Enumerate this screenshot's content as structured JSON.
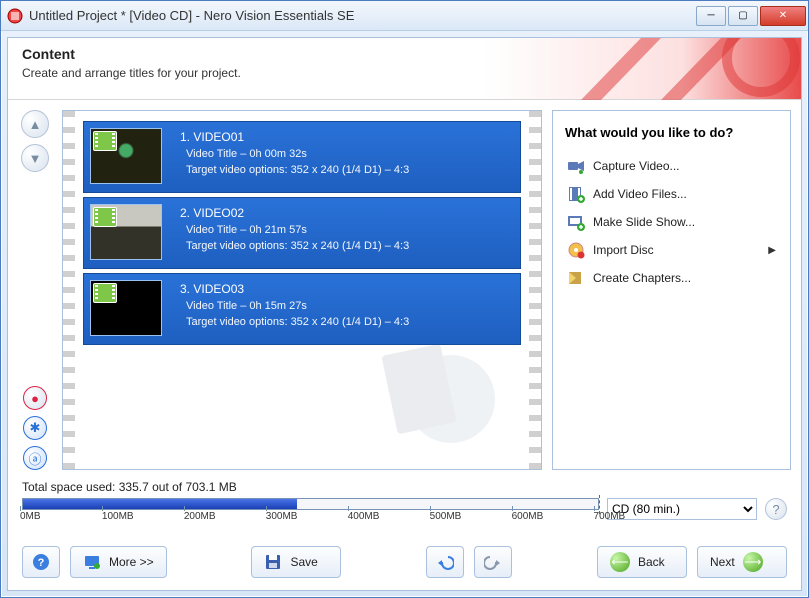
{
  "window": {
    "title": "Untitled Project * [Video CD] - Nero Vision Essentials SE"
  },
  "header": {
    "title": "Content",
    "subtitle": "Create and arrange titles for your project."
  },
  "videos": [
    {
      "index": "1.",
      "name": "VIDEO01",
      "title_line": "Video Title – 0h 00m 32s",
      "options_line": "Target video options: 352 x 240 (1/4 D1) – 4:3"
    },
    {
      "index": "2.",
      "name": "VIDEO02",
      "title_line": "Video Title – 0h 21m 57s",
      "options_line": "Target video options: 352 x 240 (1/4 D1) – 4:3"
    },
    {
      "index": "3.",
      "name": "VIDEO03",
      "title_line": "Video Title – 0h 15m 27s",
      "options_line": "Target video options: 352 x 240 (1/4 D1) – 4:3"
    }
  ],
  "side": {
    "heading": "What would you like to do?",
    "actions": [
      {
        "label": "Capture Video..."
      },
      {
        "label": "Add Video Files..."
      },
      {
        "label": "Make Slide Show..."
      },
      {
        "label": "Import Disc",
        "submenu": true
      },
      {
        "label": "Create Chapters..."
      }
    ]
  },
  "footer": {
    "space_text": "Total space used: 335.7 out of 703.1 MB",
    "ticks": [
      "0MB",
      "100MB",
      "200MB",
      "300MB",
      "400MB",
      "500MB",
      "600MB",
      "700MB"
    ],
    "fill_percent": 47.7,
    "redmark_percent": 100,
    "disc_label": "CD (80 min.)"
  },
  "buttons": {
    "more": "More >>",
    "save": "Save",
    "back": "Back",
    "next": "Next"
  }
}
